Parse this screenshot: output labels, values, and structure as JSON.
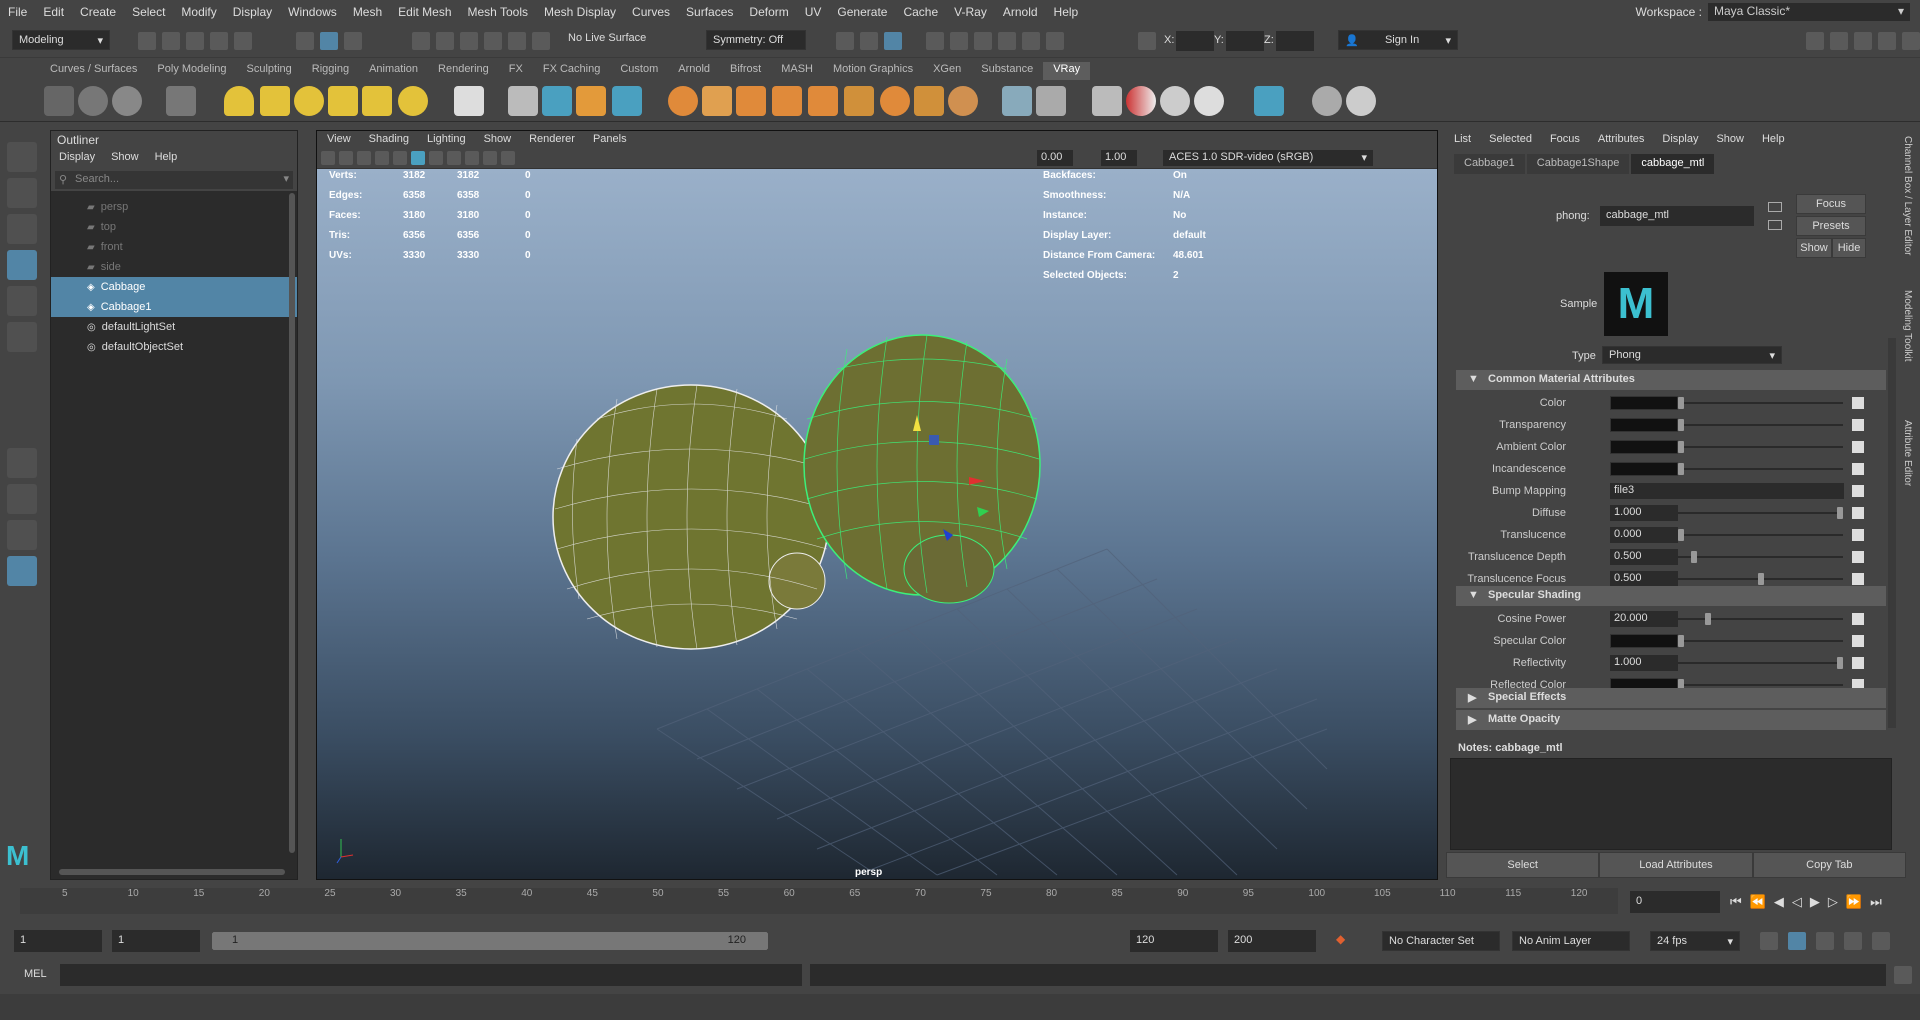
{
  "menu": [
    "File",
    "Edit",
    "Create",
    "Select",
    "Modify",
    "Display",
    "Windows",
    "Mesh",
    "Edit Mesh",
    "Mesh Tools",
    "Mesh Display",
    "Curves",
    "Surfaces",
    "Deform",
    "UV",
    "Generate",
    "Cache",
    "V-Ray",
    "Arnold",
    "Help"
  ],
  "workspace": {
    "label": "Workspace :",
    "value": "Maya Classic*"
  },
  "toolbar": {
    "mode": "Modeling",
    "live_surface": "No Live Surface",
    "symmetry": "Symmetry: Off",
    "x": "X:",
    "y": "Y:",
    "z": "Z:",
    "sign_in": "Sign In"
  },
  "shelf_tabs": [
    "Curves / Surfaces",
    "Poly Modeling",
    "Sculpting",
    "Rigging",
    "Animation",
    "Rendering",
    "FX",
    "FX Caching",
    "Custom",
    "Arnold",
    "Bifrost",
    "MASH",
    "Motion Graphics",
    "XGen",
    "Substance",
    "VRay"
  ],
  "outliner": {
    "title": "Outliner",
    "menu": [
      "Display",
      "Show",
      "Help"
    ],
    "search": "Search...",
    "items": [
      {
        "label": "persp",
        "dim": true
      },
      {
        "label": "top",
        "dim": true
      },
      {
        "label": "front",
        "dim": true
      },
      {
        "label": "side",
        "dim": true
      },
      {
        "label": "Cabbage",
        "sel": true
      },
      {
        "label": "Cabbage1",
        "sel": true
      },
      {
        "label": "defaultLightSet"
      },
      {
        "label": "defaultObjectSet"
      }
    ]
  },
  "viewport": {
    "menu": [
      "View",
      "Shading",
      "Lighting",
      "Show",
      "Renderer",
      "Panels"
    ],
    "exposure": "0.00",
    "gamma": "1.00",
    "color_space": "ACES 1.0 SDR-video (sRGB)",
    "camera": "persp",
    "stats": [
      [
        "Verts:",
        "3182",
        "3182",
        "0"
      ],
      [
        "Edges:",
        "6358",
        "6358",
        "0"
      ],
      [
        "Faces:",
        "3180",
        "3180",
        "0"
      ],
      [
        "Tris:",
        "6356",
        "6356",
        "0"
      ],
      [
        "UVs:",
        "3330",
        "3330",
        "0"
      ]
    ],
    "info": [
      [
        "Backfaces:",
        "On"
      ],
      [
        "Smoothness:",
        "N/A"
      ],
      [
        "Instance:",
        "No"
      ],
      [
        "Display Layer:",
        "default"
      ],
      [
        "Distance From Camera:",
        "48.601"
      ],
      [
        "Selected Objects:",
        "2"
      ]
    ]
  },
  "attr": {
    "menu": [
      "List",
      "Selected",
      "Focus",
      "Attributes",
      "Display",
      "Show",
      "Help"
    ],
    "tabs": [
      "Cabbage1",
      "Cabbage1Shape",
      "cabbage_mtl"
    ],
    "node_label": "phong:",
    "node_name": "cabbage_mtl",
    "focus": "Focus",
    "presets": "Presets",
    "show": "Show",
    "hide": "Hide",
    "sample": "Sample",
    "type_label": "Type",
    "type_value": "Phong",
    "sec_common": "Common Material Attributes",
    "sec_spec": "Specular Shading",
    "sec_fx": "Special Effects",
    "sec_matte": "Matte Opacity",
    "common": [
      {
        "label": "Color",
        "kind": "swatch",
        "pos": 0
      },
      {
        "label": "Transparency",
        "kind": "swatch",
        "pos": 0
      },
      {
        "label": "Ambient Color",
        "kind": "swatch",
        "pos": 0
      },
      {
        "label": "Incandescence",
        "kind": "swatch",
        "pos": 0
      },
      {
        "label": "Bump Mapping",
        "kind": "text",
        "value": "file3"
      },
      {
        "label": "Diffuse",
        "kind": "num",
        "value": "1.000",
        "pos": 1
      },
      {
        "label": "Translucence",
        "kind": "num",
        "value": "0.000",
        "pos": 0
      },
      {
        "label": "Translucence Depth",
        "kind": "num",
        "value": "0.500",
        "pos": 0.08
      },
      {
        "label": "Translucence Focus",
        "kind": "num",
        "value": "0.500",
        "pos": 0.5
      }
    ],
    "spec": [
      {
        "label": "Cosine Power",
        "kind": "num",
        "value": "20.000",
        "pos": 0.17
      },
      {
        "label": "Specular Color",
        "kind": "swatch",
        "pos": 0
      },
      {
        "label": "Reflectivity",
        "kind": "num",
        "value": "1.000",
        "pos": 1
      },
      {
        "label": "Reflected Color",
        "kind": "swatch",
        "pos": 0
      }
    ],
    "notes_label": "Notes:",
    "notes_value": "cabbage_mtl",
    "buttons": [
      "Select",
      "Load Attributes",
      "Copy Tab"
    ],
    "side_tabs": [
      "Channel Box / Layer Editor",
      "Modeling Toolkit",
      "Attribute Editor"
    ]
  },
  "timeline": {
    "ticks": [
      "5",
      "10",
      "15",
      "20",
      "25",
      "30",
      "35",
      "40",
      "45",
      "50",
      "55",
      "60",
      "65",
      "70",
      "75",
      "80",
      "85",
      "90",
      "95",
      "100",
      "105",
      "110",
      "115",
      "120"
    ],
    "current": "0"
  },
  "range": {
    "start": "1",
    "anim_start": "1",
    "slider_start": "1",
    "slider_end": "120",
    "end": "120",
    "anim_end": "200",
    "char_set": "No Character Set",
    "anim_layer": "No Anim Layer",
    "fps": "24 fps"
  },
  "cmd": {
    "label": "MEL"
  }
}
